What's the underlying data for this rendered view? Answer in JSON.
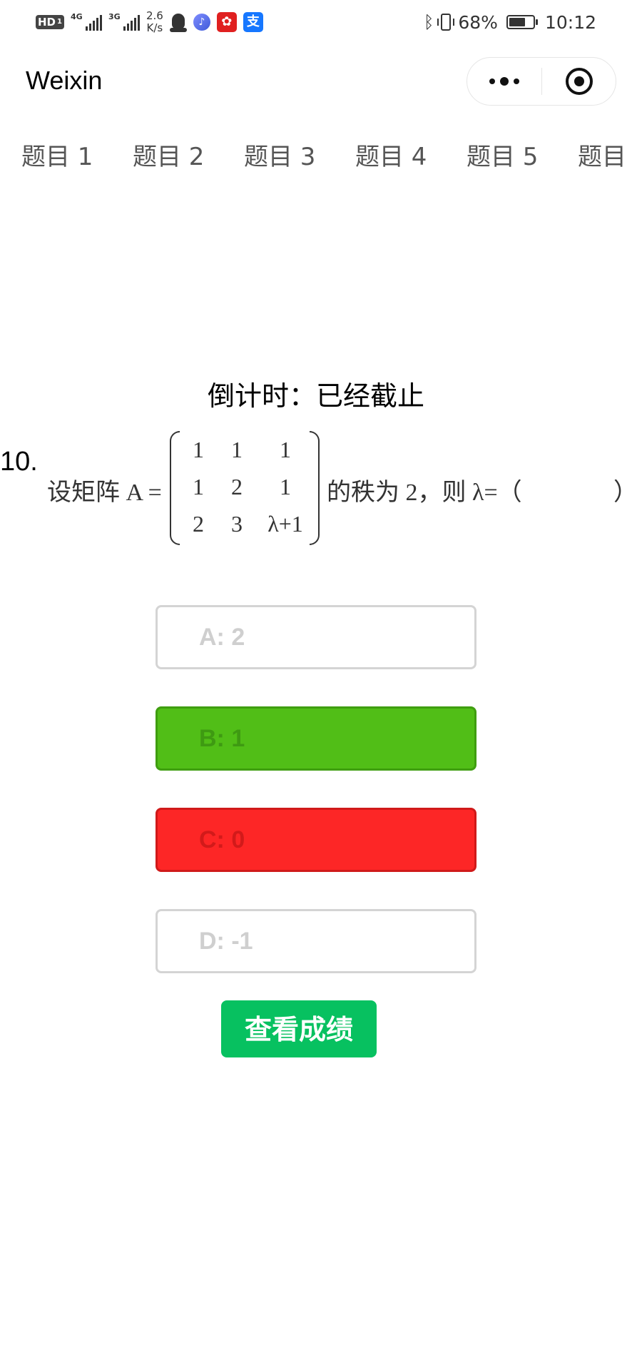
{
  "status_bar": {
    "hd_label": "HD",
    "hd_sub": "1",
    "signal_1_tag": "4G",
    "signal_2_tag": "3G",
    "net_speed_value": "2.6",
    "net_speed_unit": "K/s",
    "battery_percent": "68%",
    "battery_level": 0.68,
    "time": "10:12",
    "icons": [
      "hd-icon",
      "signal-icon",
      "signal-icon",
      "qq-icon",
      "music-icon",
      "red-app-icon",
      "alipay-icon",
      "bluetooth-icon",
      "vibrate-icon",
      "battery-icon"
    ]
  },
  "nav": {
    "title": "Weixin",
    "more_icon": "more-dots-icon",
    "close_icon": "target-icon"
  },
  "tabs": [
    "题目 1",
    "题目 2",
    "题目 3",
    "题目 4",
    "题目 5",
    "题目"
  ],
  "countdown": "倒计时：已经截止",
  "question": {
    "number": "10.",
    "prefix": "设矩阵 A =",
    "matrix": [
      [
        "1",
        "1",
        "1"
      ],
      [
        "1",
        "2",
        "1"
      ],
      [
        "2",
        "3",
        "λ+1"
      ]
    ],
    "suffix": "的秩为 2，则 λ=（",
    "closing": "）"
  },
  "options": [
    {
      "label": "A: 2",
      "state": "normal"
    },
    {
      "label": "B: 1",
      "state": "correct"
    },
    {
      "label": "C: 0",
      "state": "wrong"
    },
    {
      "label": "D: -1",
      "state": "normal"
    }
  ],
  "colors": {
    "correct": "#51be17",
    "wrong": "#fd2626",
    "primary_button": "#07c160"
  },
  "score_button": "查看成绩"
}
